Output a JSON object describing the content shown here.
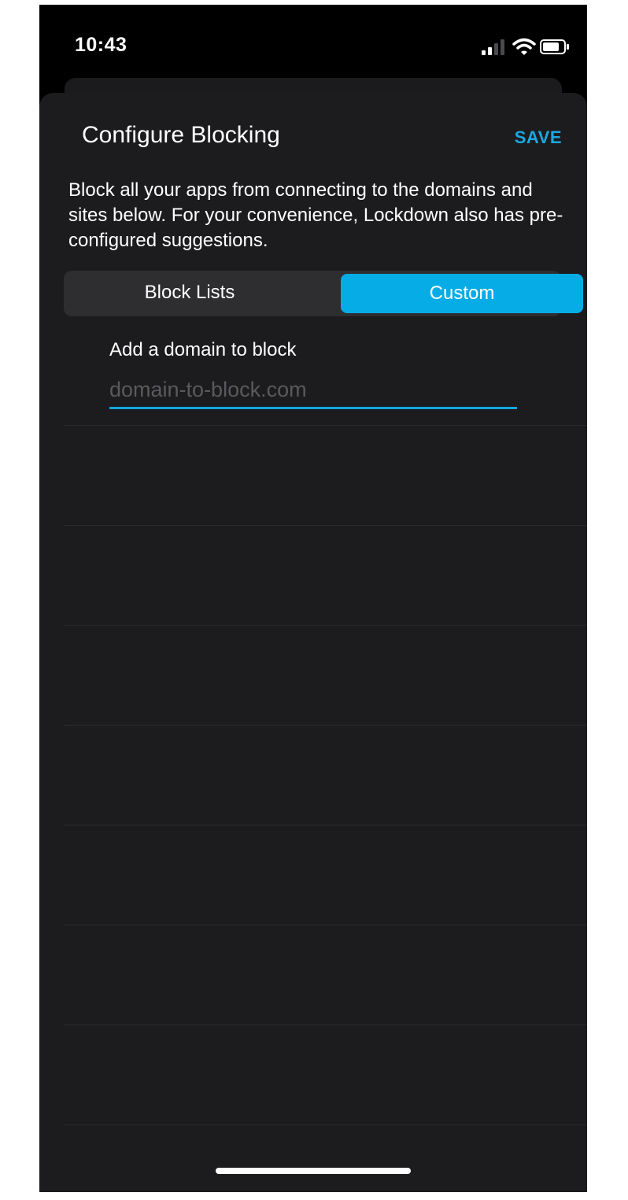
{
  "status_bar": {
    "time": "10:43",
    "icons": [
      "signal-icon",
      "wifi-icon",
      "battery-icon"
    ]
  },
  "sheet": {
    "title": "Configure Blocking",
    "save_label": "SAVE",
    "description": "Block all your apps from connecting to the domains and sites below. For your convenience, Lockdown also has pre-configured suggestions."
  },
  "segments": {
    "items": [
      {
        "label": "Block Lists",
        "selected": false
      },
      {
        "label": "Custom",
        "selected": true
      }
    ]
  },
  "domain_field": {
    "label": "Add a domain to block",
    "placeholder": "domain-to-block.com",
    "value": ""
  },
  "colors": {
    "accent": "#06ace6",
    "sheet_background": "#1c1c1e",
    "background": "#000000"
  }
}
